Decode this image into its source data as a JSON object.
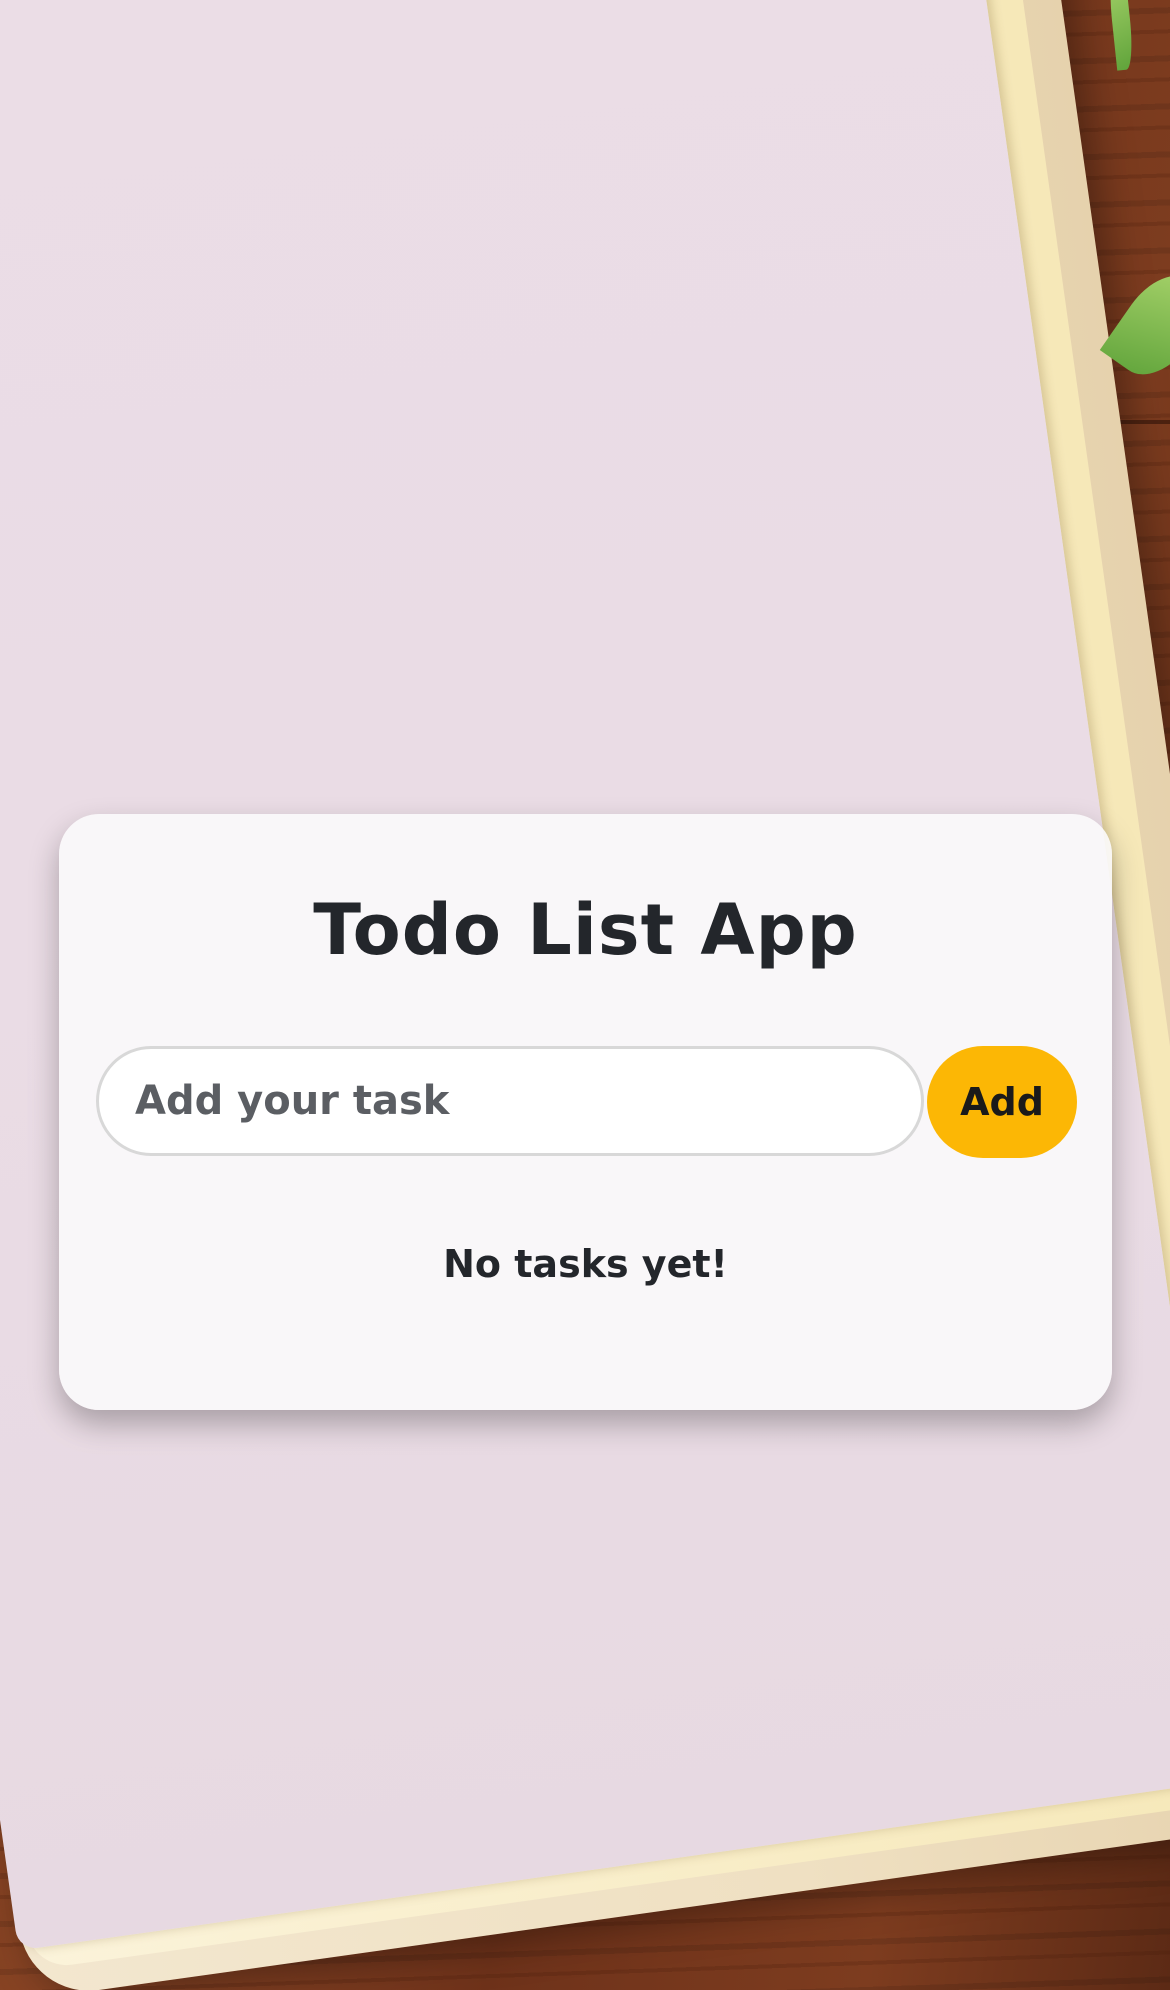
{
  "app": {
    "title": "Todo List App"
  },
  "task_input": {
    "value": "",
    "placeholder": "Add your task"
  },
  "add_button": {
    "label": "Add"
  },
  "task_list": {
    "items": [],
    "empty_message": "No tasks yet!"
  },
  "colors": {
    "accent": "#fcb705",
    "card_background": "#fbf9fb",
    "title_text": "#23262b",
    "page_background": "#eadce5",
    "wood": "#7a3b1d"
  }
}
